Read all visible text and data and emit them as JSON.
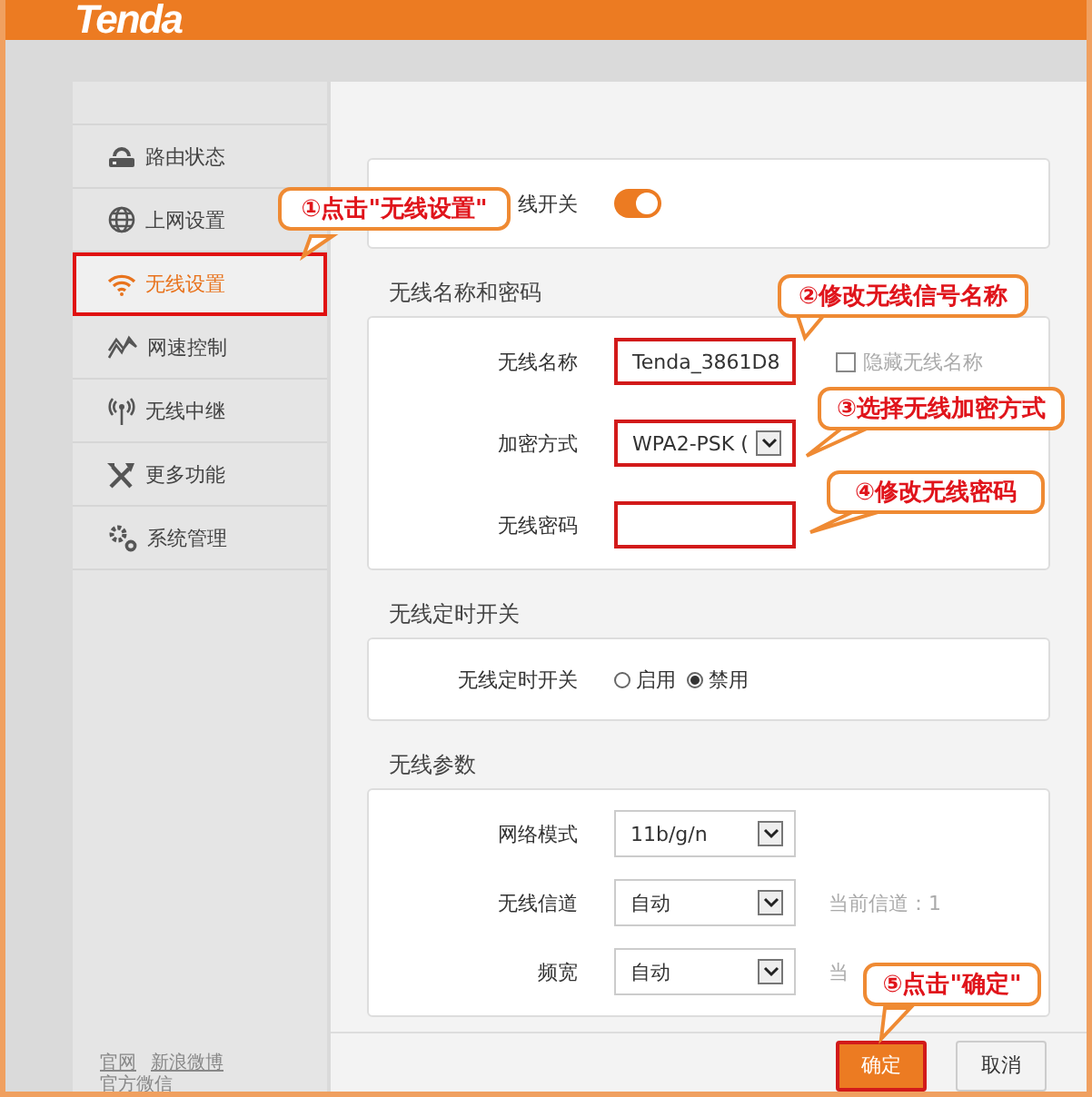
{
  "header": {
    "logo": "Tenda"
  },
  "sidebar": {
    "items": [
      {
        "label": "路由状态",
        "selected": false
      },
      {
        "label": "上网设置",
        "selected": false
      },
      {
        "label": "无线设置",
        "selected": true
      },
      {
        "label": "网速控制",
        "selected": false
      },
      {
        "label": "无线中继",
        "selected": false
      },
      {
        "label": "更多功能",
        "selected": false
      },
      {
        "label": "系统管理",
        "selected": false
      }
    ],
    "links": [
      "官网",
      "新浪微博",
      "官方微信"
    ]
  },
  "sections": [
    {
      "rows": [
        {
          "kind": "toggle",
          "label": "线开关",
          "on": true
        }
      ]
    },
    {
      "title": "无线名称和密码",
      "rows": [
        {
          "kind": "text",
          "label": "无线名称",
          "value": "Tenda_3861D8",
          "highlighted": true,
          "checkbox": {
            "label": "隐藏无线名称",
            "checked": false
          }
        },
        {
          "kind": "select",
          "label": "加密方式",
          "value": "WPA2-PSK (",
          "highlighted": true
        },
        {
          "kind": "password",
          "label": "无线密码",
          "highlighted": true
        }
      ]
    },
    {
      "title": "无线定时开关",
      "rows": [
        {
          "kind": "radio",
          "label": "无线定时开关",
          "options": [
            {
              "label": "启用",
              "selected": false
            },
            {
              "label": "禁用",
              "selected": true
            }
          ]
        }
      ]
    },
    {
      "title": "无线参数",
      "rows": [
        {
          "kind": "select",
          "label": "网络模式",
          "value": "11b/g/n",
          "highlighted": false
        },
        {
          "kind": "select",
          "label": "无线信道",
          "value": "自动",
          "highlighted": false,
          "note": "当前信道：1"
        },
        {
          "kind": "select",
          "label": "频宽",
          "value": "自动",
          "highlighted": false,
          "note": "当"
        }
      ]
    }
  ],
  "buttons": [
    {
      "label": "确定",
      "kind": "primary",
      "highlighted": true
    },
    {
      "label": "取消",
      "kind": "secondary",
      "highlighted": false
    }
  ],
  "callouts": [
    "①点击\"无线设置\"",
    "②修改无线信号名称",
    "③选择无线加密方式",
    "④修改无线密码",
    "⑤点击\"确定\""
  ]
}
